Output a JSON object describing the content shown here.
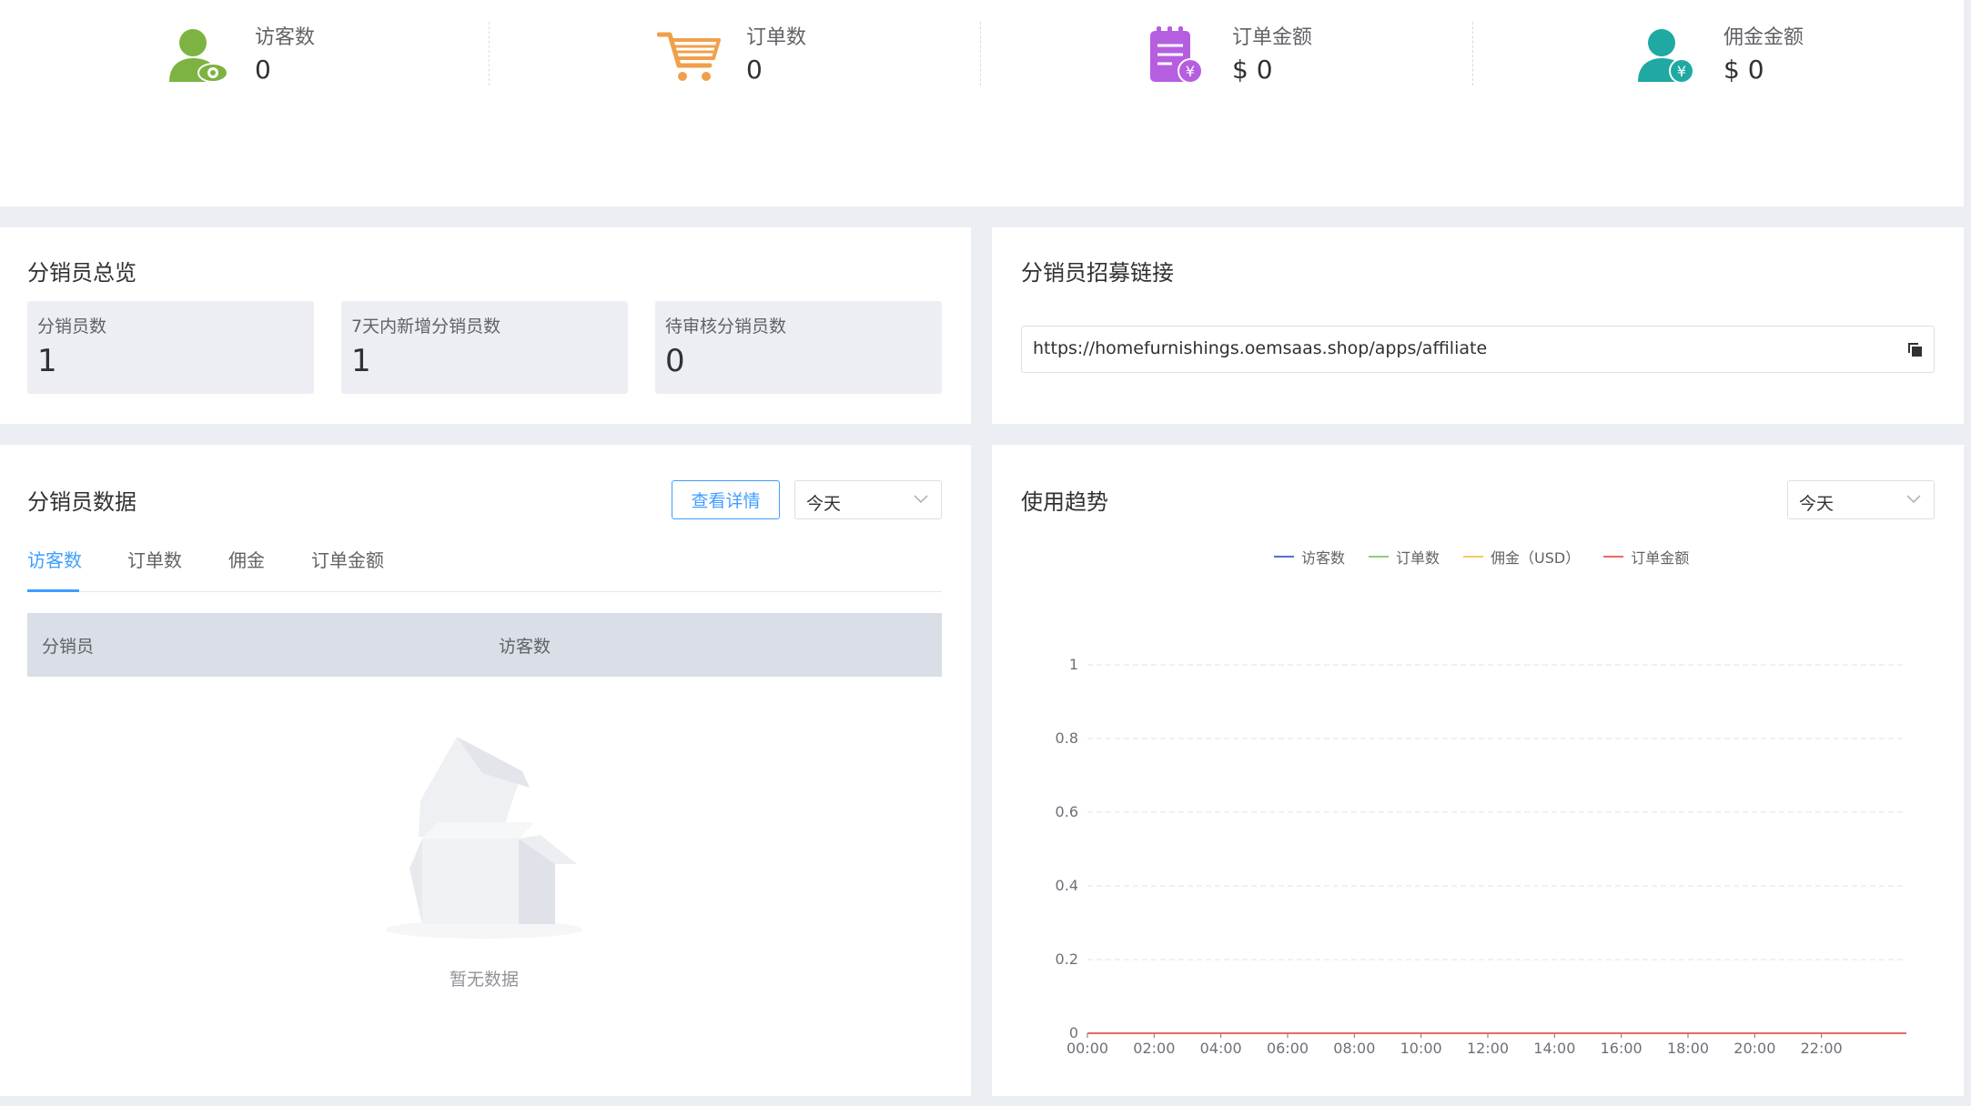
{
  "stats": [
    {
      "icon": "visitor-icon",
      "label": "访客数",
      "value": "0"
    },
    {
      "icon": "cart-icon",
      "label": "订单数",
      "value": "0"
    },
    {
      "icon": "order-amount-icon",
      "label": "订单金额",
      "value": "$ 0"
    },
    {
      "icon": "commission-icon",
      "label": "佣金金额",
      "value": "$ 0"
    }
  ],
  "overview": {
    "title": "分销员总览",
    "boxes": [
      {
        "label": "分销员数",
        "value": "1"
      },
      {
        "label": "7天内新增分销员数",
        "value": "1"
      },
      {
        "label": "待审核分销员数",
        "value": "0"
      }
    ]
  },
  "recruit": {
    "title": "分销员招募链接",
    "url": "https://homefurnishings.oemsaas.shop/apps/affiliate",
    "copy_icon": "copy-icon"
  },
  "affiliate_data": {
    "title": "分销员数据",
    "detail_button": "查看详情",
    "period": "今天",
    "tabs": [
      "访客数",
      "订单数",
      "佣金",
      "订单金额"
    ],
    "active_tab": 0,
    "columns": [
      "分销员",
      "访客数"
    ],
    "rows": [],
    "empty_text": "暂无数据"
  },
  "trend": {
    "title": "使用趋势",
    "period": "今天"
  },
  "colors": {
    "accent": "#409eff",
    "visitor": "#5b8ff9",
    "orders": "#91cc75",
    "commission": "#fac858",
    "amount": "#ee6666"
  },
  "chart_data": {
    "type": "line",
    "x": [
      "00:00",
      "02:00",
      "04:00",
      "06:00",
      "08:00",
      "10:00",
      "12:00",
      "14:00",
      "16:00",
      "18:00",
      "20:00",
      "22:00"
    ],
    "series": [
      {
        "name": "访客数",
        "color": "#5470c6",
        "values": [
          0,
          0,
          0,
          0,
          0,
          0,
          0,
          0,
          0,
          0,
          0,
          0
        ]
      },
      {
        "name": "订单数",
        "color": "#91cc75",
        "values": [
          0,
          0,
          0,
          0,
          0,
          0,
          0,
          0,
          0,
          0,
          0,
          0
        ]
      },
      {
        "name": "佣金（USD）",
        "color": "#fac858",
        "values": [
          0,
          0,
          0,
          0,
          0,
          0,
          0,
          0,
          0,
          0,
          0,
          0
        ]
      },
      {
        "name": "订单金额",
        "color": "#ee6666",
        "values": [
          0,
          0,
          0,
          0,
          0,
          0,
          0,
          0,
          0,
          0,
          0,
          0
        ]
      }
    ],
    "yticks": [
      "0",
      "0.2",
      "0.4",
      "0.6",
      "0.8",
      "1"
    ],
    "ylim": [
      0,
      1
    ],
    "grid": true,
    "legend": "top-center"
  }
}
